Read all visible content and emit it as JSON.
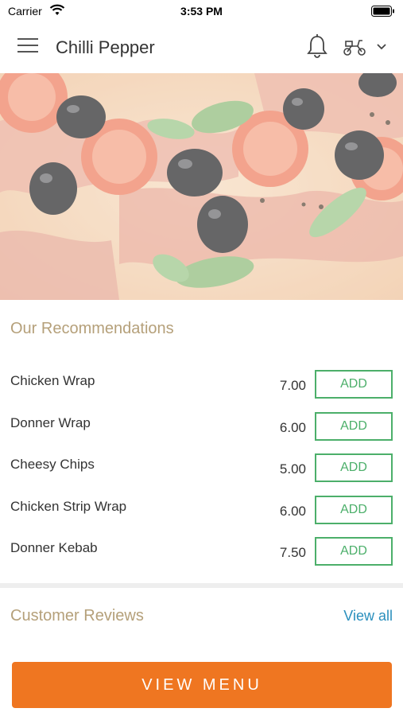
{
  "status_bar": {
    "carrier": "Carrier",
    "time": "3:53 PM"
  },
  "header": {
    "title": "Chilli Pepper",
    "icons": [
      "menu-icon",
      "bell-icon",
      "scooter-icon",
      "chevron-down-icon"
    ]
  },
  "recommendations": {
    "title": "Our Recommendations",
    "add_label": "ADD",
    "items": [
      {
        "name": "Chicken Wrap",
        "price": "7.00"
      },
      {
        "name": "Donner Wrap",
        "price": "6.00"
      },
      {
        "name": "Cheesy Chips",
        "price": "5.00"
      },
      {
        "name": "Chicken Strip Wrap",
        "price": "6.00"
      },
      {
        "name": "Donner Kebab",
        "price": "7.50"
      }
    ]
  },
  "reviews": {
    "title": "Customer Reviews",
    "view_all_label": "View all"
  },
  "footer": {
    "view_menu_label": "VIEW MENU"
  },
  "colors": {
    "accent_orange": "#ef7621",
    "add_green": "#4caf6a",
    "section_title_tan": "#b5a07a",
    "link_blue": "#2a8fbd"
  }
}
